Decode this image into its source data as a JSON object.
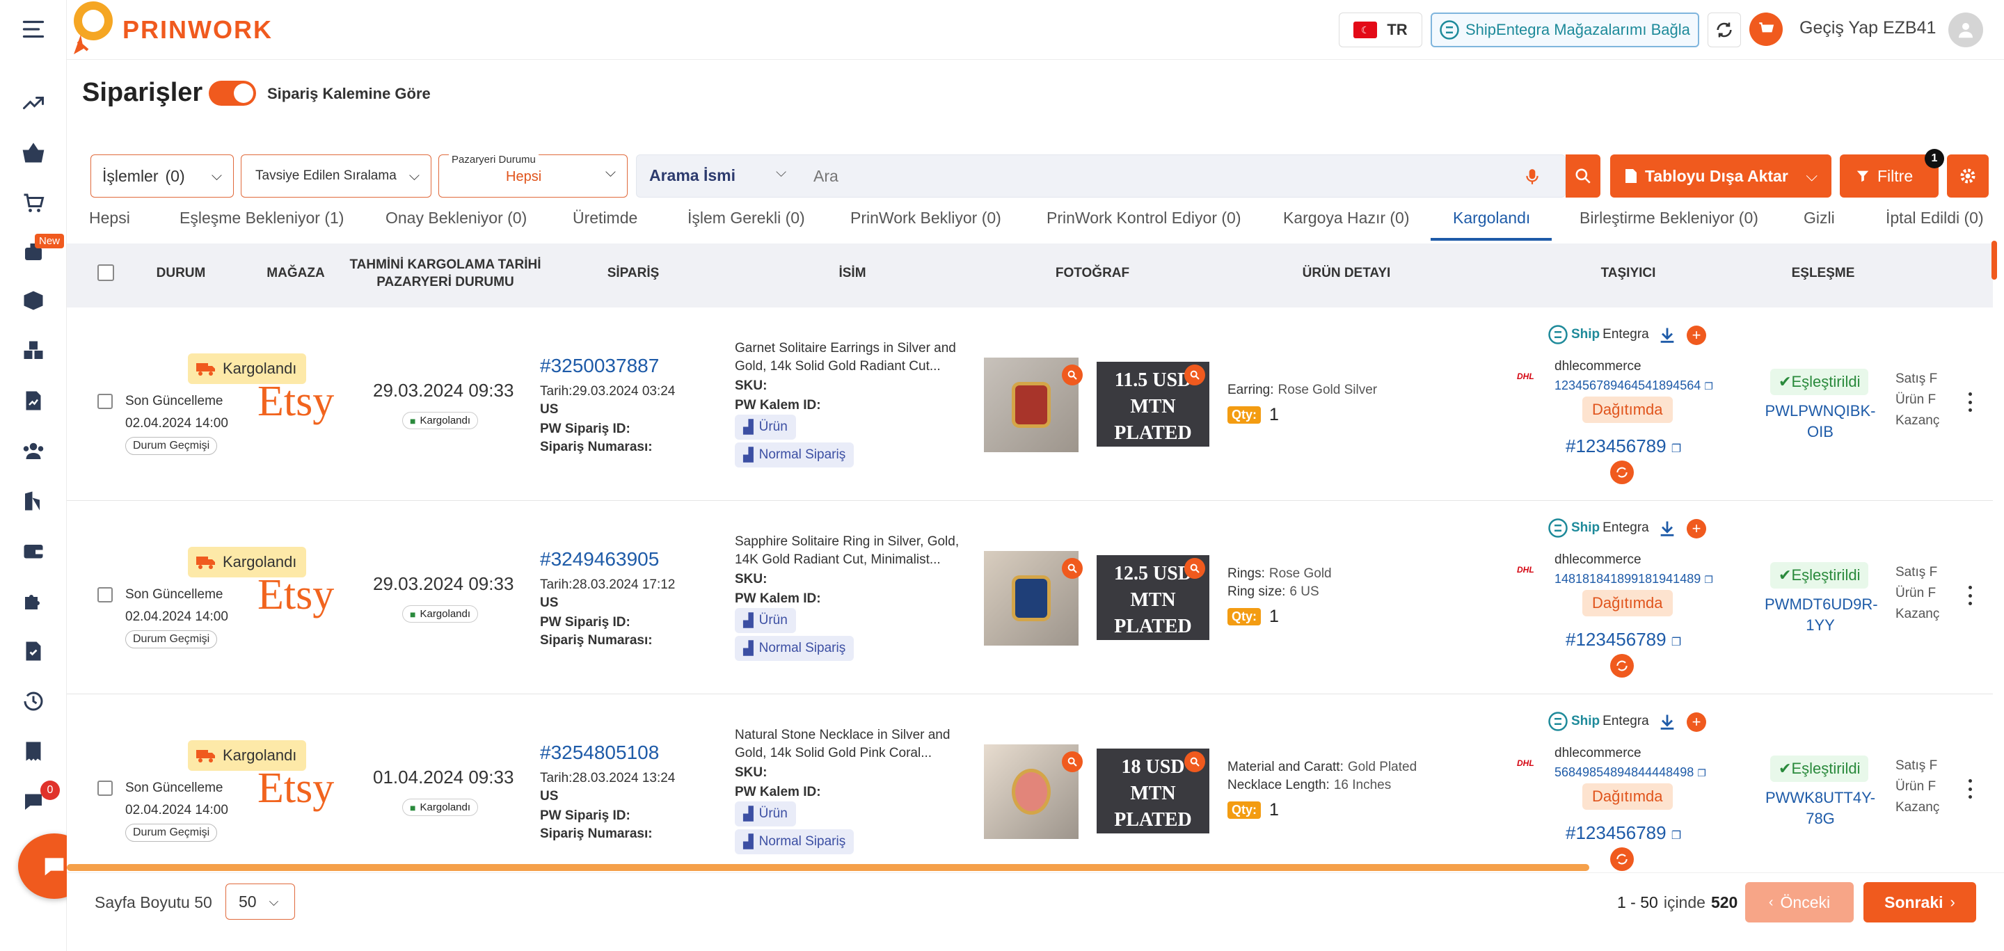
{
  "app": {
    "logo_text": "PRINWORK"
  },
  "topbar": {
    "lang": "TR",
    "ship_connect": "ShipEntegra Mağazalarımı Bağla",
    "switch_user": "Geçiş Yap EZB41"
  },
  "page": {
    "title": "Siparişler",
    "toggle_label": "Sipariş Kalemine Göre"
  },
  "sidebar": {
    "new_badge": "New",
    "chat_count": "0"
  },
  "filters": {
    "actions_label": "İşlemler",
    "actions_count": "(0)",
    "sort_label": "Tavsiye Edilen Sıralama",
    "market_label": "Pazaryeri Durumu",
    "market_value": "Hepsi",
    "search_field": "Arama İsmi",
    "search_placeholder": "Ara",
    "export_label": "Tabloyu Dışa Aktar",
    "filter_label": "Filtre",
    "filter_count": "1"
  },
  "tabs": [
    "Hepsi",
    "Eşleşme Bekleniyor (1)",
    "Onay Bekleniyor (0)",
    "Üretimde",
    "İşlem Gerekli (0)",
    "PrinWork Bekliyor (0)",
    "PrinWork Kontrol Ediyor (0)",
    "Kargoya Hazır (0)",
    "Kargolandı",
    "Birleştirme Bekleniyor (0)",
    "Gizli",
    "İptal Edildi (0)"
  ],
  "table": {
    "headers": {
      "status": "DURUM",
      "store": "MAĞAZA",
      "ship_date_1": "TAHMİNİ KARGOLAMA TARİHİ",
      "ship_date_2": "PAZARYERİ DURUMU",
      "order": "SİPARİŞ",
      "name": "İSİM",
      "photo": "FOTOĞRAF",
      "detail": "ÜRÜN DETAYI",
      "carrier": "TAŞIYICI",
      "match": "EŞLEŞME"
    }
  },
  "common": {
    "status": "Kargolandı",
    "last_update": "Son Güncelleme",
    "last_update_date": "02.04.2024 14:00",
    "history": "Durum Geçmişi",
    "store": "Etsy",
    "market_status": "Kargolandı",
    "country": "US",
    "pw_order": "PW Sipariş ID:",
    "order_no": "Sipariş Numarası:",
    "sku": "SKU:",
    "pw_item": "PW Kalem ID:",
    "product_tag": "Ürün",
    "normal_tag": "Normal Sipariş",
    "qty_label": "Qty:",
    "ship_brand_a": "Ship",
    "ship_brand_b": "Entegra",
    "carrier_name": "dhlecommerce",
    "distribution": "Dağıtımda",
    "tracking": "#123456789",
    "matched": "Eşleştirildi",
    "side_1": "Satış F",
    "side_2": "Ürün F",
    "side_3": "Kazanç",
    "dhl": "DHL"
  },
  "rows": [
    {
      "ship_date": "29.03.2024 09:33",
      "order_id": "#3250037887",
      "order_date": "Tarih:29.03.2024 03:24",
      "name_1": "Garnet Solitaire Earrings in Silver and",
      "name_2": "Gold, 14k Solid Gold Radiant Cut...",
      "mtn_1": "11.5 USD",
      "mtn_2": "MTN",
      "mtn_3": "PLATED",
      "detail_1_key": "Earring:",
      "detail_1_val": "Rose Gold Silver",
      "detail_2_key": "",
      "detail_2_val": "",
      "qty": "1",
      "carrier_code": "12345678946454189456​4",
      "match_code_1": "PWLPWNQIBK-",
      "match_code_2": "OIB"
    },
    {
      "ship_date": "29.03.2024 09:33",
      "order_id": "#3249463905",
      "order_date": "Tarih:28.03.2024 17:12",
      "name_1": "Sapphire Solitaire Ring in Silver, Gold,",
      "name_2": "14K Gold Radiant Cut, Minimalist...",
      "mtn_1": "12.5 USD",
      "mtn_2": "MTN",
      "mtn_3": "PLATED",
      "detail_1_key": "Rings:",
      "detail_1_val": "Rose Gold",
      "detail_2_key": "Ring size:",
      "detail_2_val": "6 US",
      "qty": "1",
      "carrier_code": "14818184189918194148​9",
      "match_code_1": "PWMDT6UD9R-",
      "match_code_2": "1YY"
    },
    {
      "ship_date": "01.04.2024 09:33",
      "order_id": "#3254805108",
      "order_date": "Tarih:28.03.2024 13:24",
      "name_1": "Natural Stone Necklace in Silver and",
      "name_2": "Gold, 14k Solid Gold Pink Coral...",
      "mtn_1": "18 USD",
      "mtn_2": "MTN",
      "mtn_3": "PLATED",
      "detail_1_key": "Material and Caratt:",
      "detail_1_val": "Gold Plated",
      "detail_2_key": "Necklace Length:",
      "detail_2_val": "16 Inches",
      "qty": "1",
      "carrier_code": "56849854894844448498",
      "match_code_1": "PWWK8UTT4Y-",
      "match_code_2": "78G"
    }
  ],
  "pagination": {
    "page_size_label": "Sayfa Boyutu 50",
    "page_size": "50",
    "range": "1 - 50",
    "of_label": "içinde",
    "total": "520",
    "prev": "Önceki",
    "next": "Sonraki"
  },
  "colors": {
    "accent": "#f05a1e",
    "link": "#1e5ba8"
  }
}
